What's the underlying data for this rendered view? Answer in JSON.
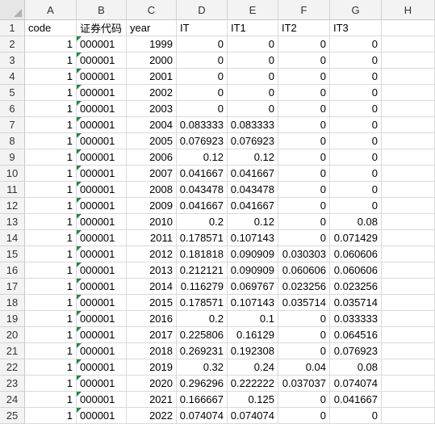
{
  "columns": [
    "A",
    "B",
    "C",
    "D",
    "E",
    "F",
    "G",
    "H"
  ],
  "headers": [
    "code",
    "证券代码",
    "year",
    "IT",
    "IT1",
    "IT2",
    "IT3",
    ""
  ],
  "rows": [
    [
      "1",
      "000001",
      "1999",
      "0",
      "0",
      "0",
      "0"
    ],
    [
      "1",
      "000001",
      "2000",
      "0",
      "0",
      "0",
      "0"
    ],
    [
      "1",
      "000001",
      "2001",
      "0",
      "0",
      "0",
      "0"
    ],
    [
      "1",
      "000001",
      "2002",
      "0",
      "0",
      "0",
      "0"
    ],
    [
      "1",
      "000001",
      "2003",
      "0",
      "0",
      "0",
      "0"
    ],
    [
      "1",
      "000001",
      "2004",
      "0.083333",
      "0.083333",
      "0",
      "0"
    ],
    [
      "1",
      "000001",
      "2005",
      "0.076923",
      "0.076923",
      "0",
      "0"
    ],
    [
      "1",
      "000001",
      "2006",
      "0.12",
      "0.12",
      "0",
      "0"
    ],
    [
      "1",
      "000001",
      "2007",
      "0.041667",
      "0.041667",
      "0",
      "0"
    ],
    [
      "1",
      "000001",
      "2008",
      "0.043478",
      "0.043478",
      "0",
      "0"
    ],
    [
      "1",
      "000001",
      "2009",
      "0.041667",
      "0.041667",
      "0",
      "0"
    ],
    [
      "1",
      "000001",
      "2010",
      "0.2",
      "0.12",
      "0",
      "0.08"
    ],
    [
      "1",
      "000001",
      "2011",
      "0.178571",
      "0.107143",
      "0",
      "0.071429"
    ],
    [
      "1",
      "000001",
      "2012",
      "0.181818",
      "0.090909",
      "0.030303",
      "0.060606"
    ],
    [
      "1",
      "000001",
      "2013",
      "0.212121",
      "0.090909",
      "0.060606",
      "0.060606"
    ],
    [
      "1",
      "000001",
      "2014",
      "0.116279",
      "0.069767",
      "0.023256",
      "0.023256"
    ],
    [
      "1",
      "000001",
      "2015",
      "0.178571",
      "0.107143",
      "0.035714",
      "0.035714"
    ],
    [
      "1",
      "000001",
      "2016",
      "0.2",
      "0.1",
      "0",
      "0.033333"
    ],
    [
      "1",
      "000001",
      "2017",
      "0.225806",
      "0.16129",
      "0",
      "0.064516"
    ],
    [
      "1",
      "000001",
      "2018",
      "0.269231",
      "0.192308",
      "0",
      "0.076923"
    ],
    [
      "1",
      "000001",
      "2019",
      "0.32",
      "0.24",
      "0.04",
      "0.08"
    ],
    [
      "1",
      "000001",
      "2020",
      "0.296296",
      "0.222222",
      "0.037037",
      "0.074074"
    ],
    [
      "1",
      "000001",
      "2021",
      "0.166667",
      "0.125",
      "0",
      "0.041667"
    ],
    [
      "1",
      "000001",
      "2022",
      "0.074074",
      "0.074074",
      "0",
      "0"
    ]
  ],
  "colors": {
    "error_flag": "#1f8a3a",
    "header_bg": "#f3f3f3",
    "gridline": "#dadada"
  }
}
